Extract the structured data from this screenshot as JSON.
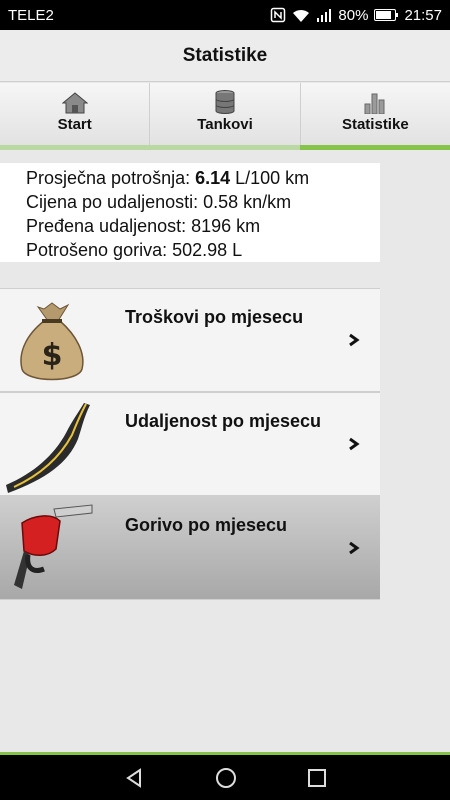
{
  "status_bar": {
    "carrier": "TELE2",
    "battery": "80%",
    "time": "21:57"
  },
  "header": {
    "title": "Statistike"
  },
  "tabs": [
    {
      "label": "Start",
      "icon": "house-icon"
    },
    {
      "label": "Tankovi",
      "icon": "fuel-barrels-icon"
    },
    {
      "label": "Statistike",
      "icon": "bar-chart-icon",
      "active": true
    }
  ],
  "stats": {
    "avg_label": "Prosječna potrošnja: ",
    "avg_value": "6.14",
    "avg_unit": " L/100 km",
    "cost_line": "Cijena po udaljenosti: 0.58 kn/km",
    "distance_line": "Pređena udaljenost: 8196 km",
    "fuel_line": "Potrošeno goriva: 502.98 L"
  },
  "menu": [
    {
      "label": "Troškovi po mjesecu",
      "icon": "money-bag-icon"
    },
    {
      "label": "Udaljenost po mjesecu",
      "icon": "road-icon"
    },
    {
      "label": "Gorivo po mjesecu",
      "icon": "fuel-nozzle-icon",
      "selected": true
    }
  ],
  "colors": {
    "accent": "#86c34a",
    "accent_light": "#b9d8a2"
  }
}
